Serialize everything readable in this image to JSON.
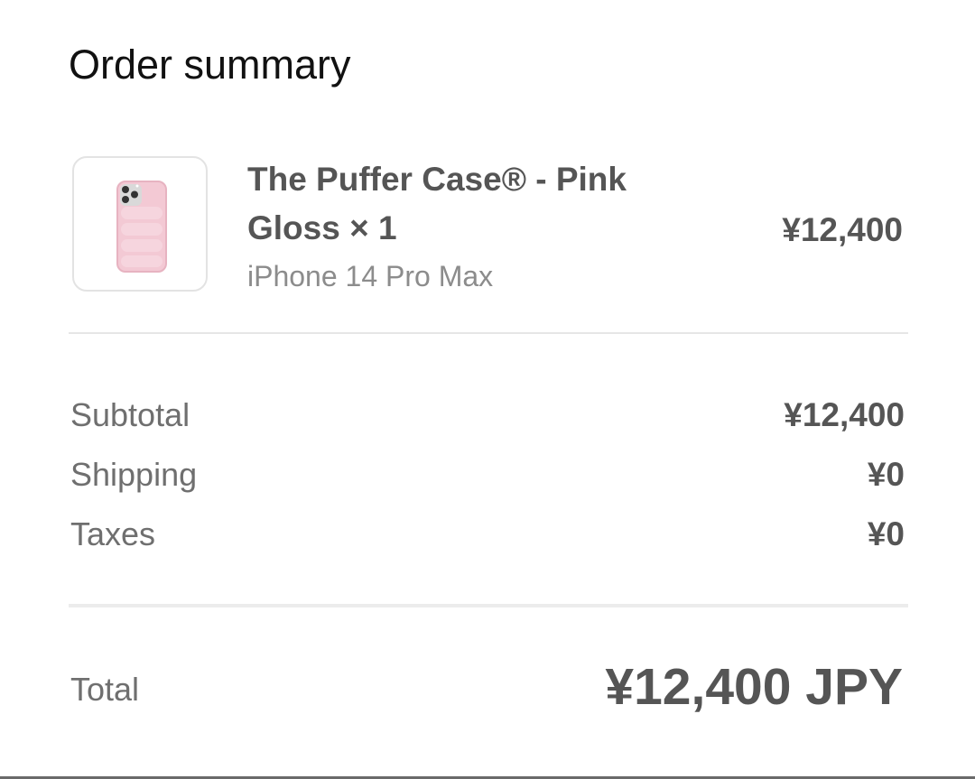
{
  "header": {
    "title": "Order summary"
  },
  "item": {
    "image_icon": "pink-puffer-phone-case-image",
    "name": "The Puffer Case® - Pink Gloss × 1",
    "variant": "iPhone 14 Pro Max",
    "price": "¥12,400"
  },
  "costs": {
    "subtotal_label": "Subtotal",
    "subtotal_value": "¥12,400",
    "shipping_label": "Shipping",
    "shipping_value": "¥0",
    "taxes_label": "Taxes",
    "taxes_value": "¥0"
  },
  "total": {
    "label": "Total",
    "value": "¥12,400 JPY"
  },
  "colors": {
    "case_pink": "#efbfcc",
    "text_dark": "#555555",
    "text_muted": "#8c8c8c"
  }
}
